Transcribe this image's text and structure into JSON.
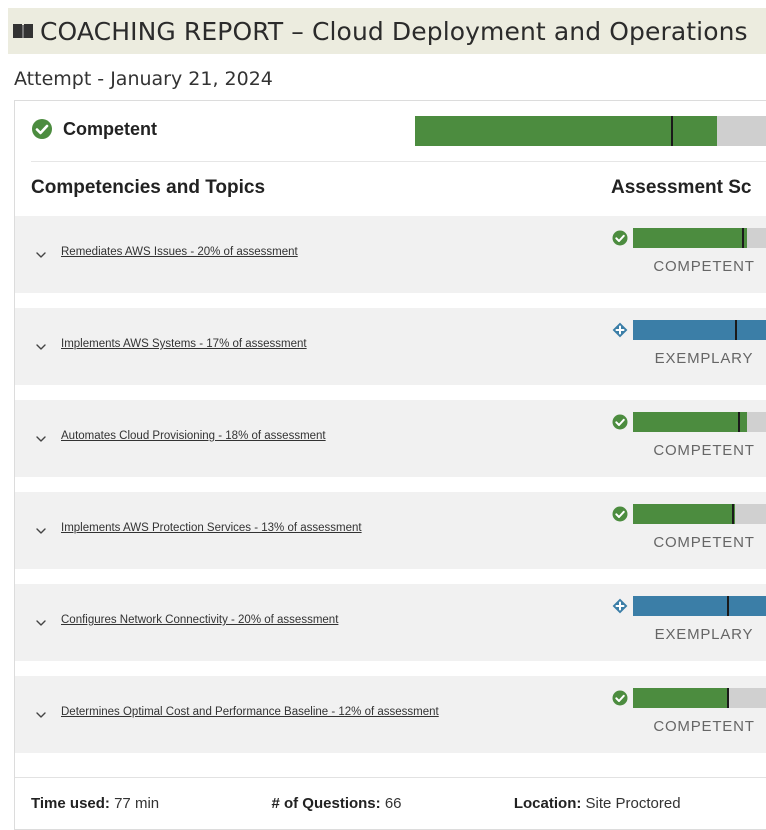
{
  "header": {
    "icon": "book-icon",
    "title": "COACHING REPORT – Cloud Deployment and Operations"
  },
  "attempt": {
    "label": "Attempt - January 21, 2024"
  },
  "overall": {
    "status": "Competent",
    "status_icon": "check-circle-icon",
    "fill_percent": 84,
    "marker_percent": 71,
    "fill_color": "#4c8c3f"
  },
  "columns": {
    "left": "Competencies and Topics",
    "right": "Assessment Sc"
  },
  "competencies": [
    {
      "label": "Remediates AWS Issues - 20% of assessment",
      "level": "COMPETENT",
      "icon": "check-circle-icon",
      "color": "#4c8c3f",
      "fill_percent": 80,
      "marker_percent": 77
    },
    {
      "label": "Implements AWS Systems - 17% of assessment",
      "level": "EXEMPLARY",
      "icon": "diamond-plus-icon",
      "color": "#3b7ea7",
      "fill_percent": 100,
      "marker_percent": 72
    },
    {
      "label": "Automates Cloud Provisioning - 18% of assessment",
      "level": "COMPETENT",
      "icon": "check-circle-icon",
      "color": "#4c8c3f",
      "fill_percent": 80,
      "marker_percent": 74
    },
    {
      "label": "Implements AWS Protection Services - 13% of assessment",
      "level": "COMPETENT",
      "icon": "check-circle-icon",
      "color": "#4c8c3f",
      "fill_percent": 72,
      "marker_percent": 70
    },
    {
      "label": "Configures Network Connectivity - 20% of assessment",
      "level": "EXEMPLARY",
      "icon": "diamond-plus-icon",
      "color": "#3b7ea7",
      "fill_percent": 100,
      "marker_percent": 66
    },
    {
      "label": "Determines Optimal Cost and Performance Baseline - 12% of assessment",
      "level": "COMPETENT",
      "icon": "check-circle-icon",
      "color": "#4c8c3f",
      "fill_percent": 67,
      "marker_percent": 66
    }
  ],
  "footer": {
    "time_used_label": "Time used:",
    "time_used_value": "77 min",
    "questions_label": "# of Questions:",
    "questions_value": "66",
    "location_label": "Location:",
    "location_value": "Site Proctored"
  }
}
